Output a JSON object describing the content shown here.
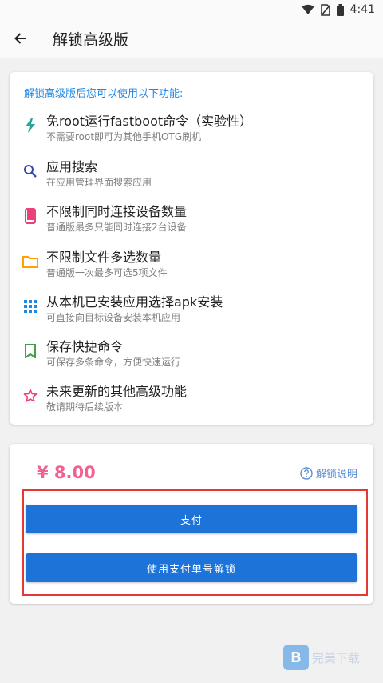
{
  "status_bar": {
    "time": "4:41"
  },
  "app_bar": {
    "title": "解锁高级版"
  },
  "features": {
    "header": "解锁高级版后您可以使用以下功能:",
    "items": [
      {
        "icon": "lightning-icon",
        "color": "#26a69a",
        "title": "免root运行fastboot命令（实验性）",
        "desc": "不需要root即可为其他手机OTG刷机"
      },
      {
        "icon": "search-icon",
        "color": "#3949ab",
        "title": "应用搜索",
        "desc": "在应用管理界面搜索应用"
      },
      {
        "icon": "phone-icon",
        "color": "#ec407a",
        "title": "不限制同时连接设备数量",
        "desc": "普通版最多只能同时连接2台设备"
      },
      {
        "icon": "folder-icon",
        "color": "#ffa000",
        "title": "不限制文件多选数量",
        "desc": "普通版一次最多可选5项文件"
      },
      {
        "icon": "grid-icon",
        "color": "#1e88e5",
        "title": "从本机已安装应用选择apk安装",
        "desc": "可直接向目标设备安装本机应用"
      },
      {
        "icon": "bookmark-icon",
        "color": "#43a047",
        "title": "保存快捷命令",
        "desc": "可保存多条命令，方便快速运行"
      },
      {
        "icon": "star-outline-icon",
        "color": "#ec407a",
        "title": "未来更新的其他高级功能",
        "desc": "敬请期待后续版本"
      }
    ]
  },
  "payment": {
    "price": "¥ 8.00",
    "help_label": "解锁说明",
    "pay_button": "支付",
    "unlock_button": "使用支付单号解锁"
  },
  "watermark": {
    "text": "完美下载"
  },
  "colors": {
    "accent": "#1e73d9",
    "price": "#f06292",
    "highlight": "#e53935"
  }
}
